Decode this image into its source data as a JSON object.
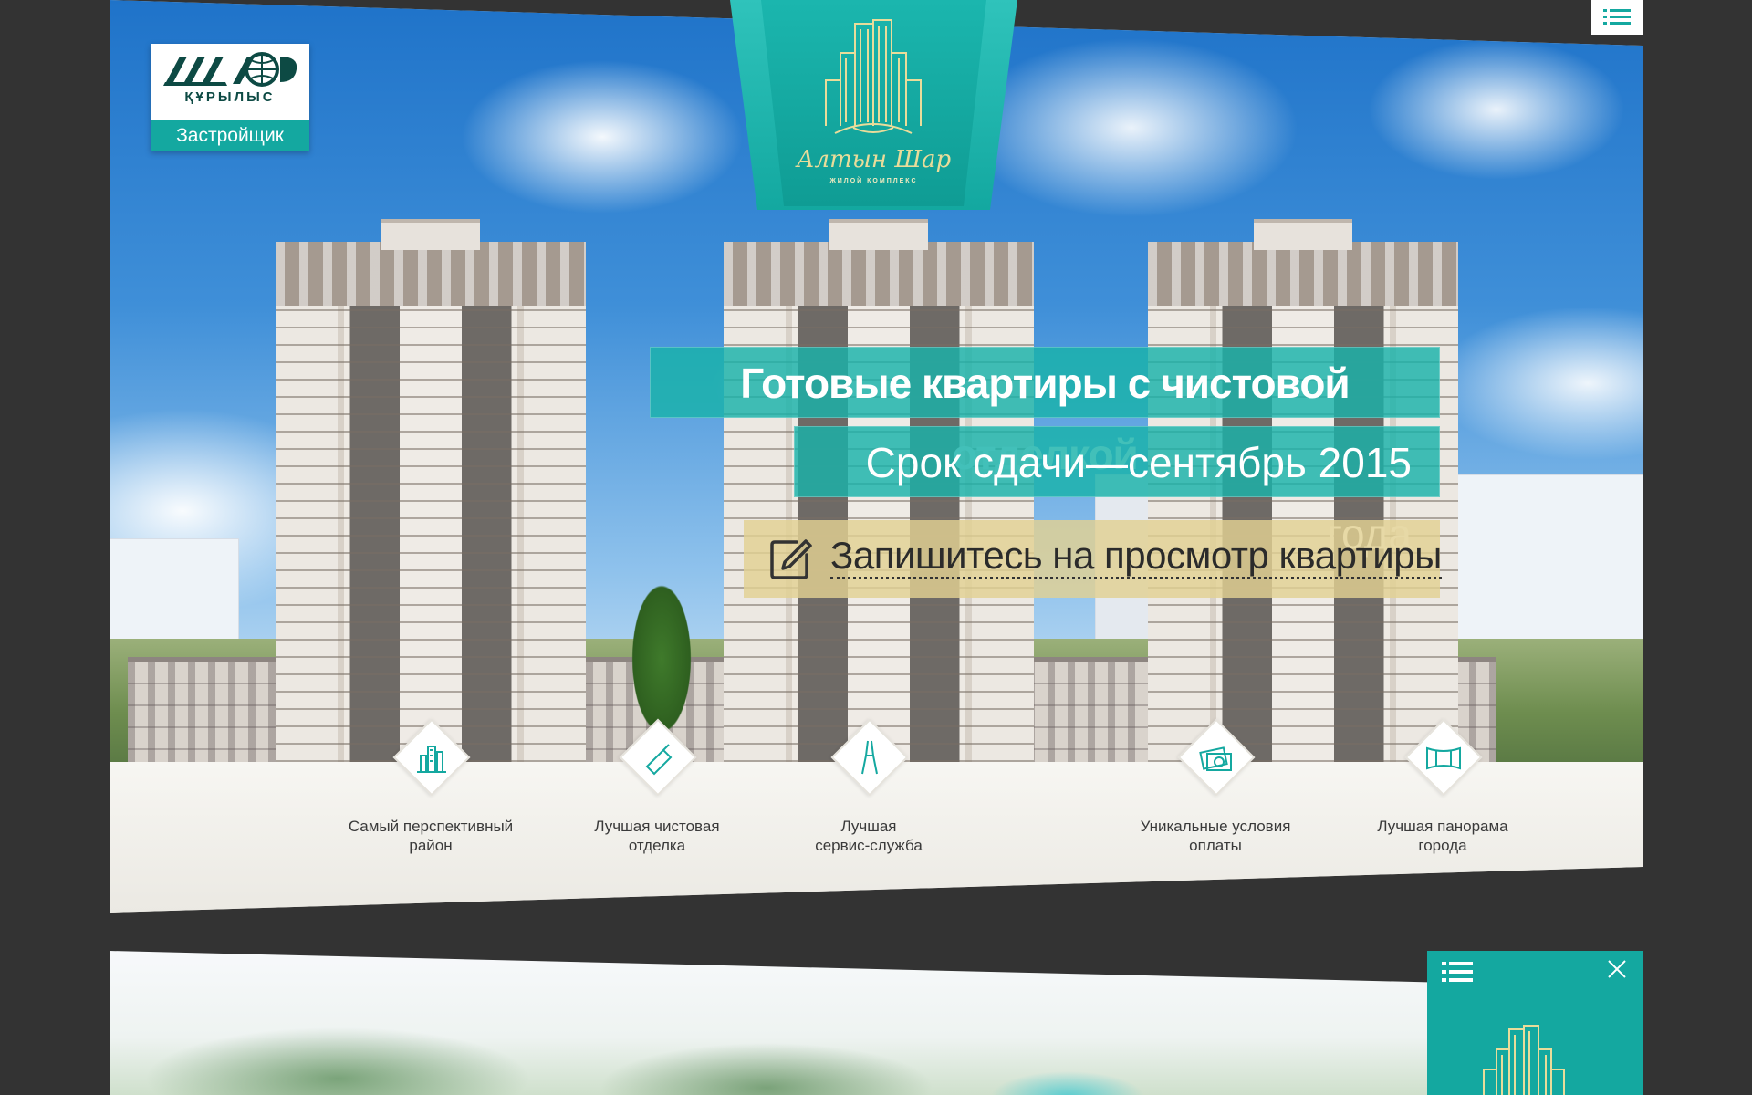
{
  "developer": {
    "brand_name": "ШАР",
    "brand_subtitle": "ҚҰРЫЛЫС",
    "role": "Застройщик"
  },
  "emblem": {
    "name": "Алтын Шар",
    "tagline": "ЖИЛОЙ КОМПЛЕКС"
  },
  "hero": {
    "headline": "Готовые квартиры с чистовой отделкой",
    "subheadline": "Срок сдачи—сентябрь 2015 года",
    "cta_label": "Запишитесь на просмотр квартиры"
  },
  "slider": {
    "total": 7,
    "active_index": 0
  },
  "features": [
    {
      "icon": "building-icon",
      "label": "Самый перспективный\nрайон"
    },
    {
      "icon": "trowel-icon",
      "label": "Лучшая чистовая\nотделка"
    },
    {
      "icon": "pliers-icon",
      "label": "Лучшая\nсервис-служба"
    },
    {
      "icon": "money-icon",
      "label": "Уникальные условия\nоплаты"
    },
    {
      "icon": "panorama-icon",
      "label": "Лучшая панорама\nгорода"
    }
  ],
  "colors": {
    "accent": "#14a8a0",
    "gold": "#e2d193",
    "background": "#333333"
  }
}
